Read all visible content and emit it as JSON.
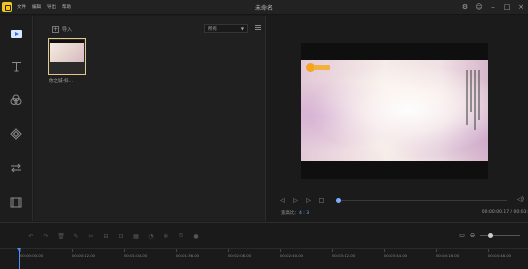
{
  "app": {
    "title": "未命名",
    "menu": [
      "文件",
      "编辑",
      "导出",
      "帮助"
    ]
  },
  "sidebar": {
    "items": [
      {
        "name": "media",
        "icon": "play-icon",
        "active": true
      },
      {
        "name": "text",
        "icon": "text-T-icon"
      },
      {
        "name": "filters",
        "icon": "three-circles-icon"
      },
      {
        "name": "overlays",
        "icon": "diamond-icon"
      },
      {
        "name": "transitions",
        "icon": "arrows-icon"
      },
      {
        "name": "elements",
        "icon": "film-icon"
      }
    ]
  },
  "library": {
    "import_label": "导入",
    "filter_value": "所有",
    "items": [
      {
        "label": "你之城-抖..."
      }
    ]
  },
  "preview": {
    "ratio_label": "宽高比：",
    "ratio_value": "4 : 3",
    "time_current": "00:00:00.17",
    "time_separator": " / ",
    "time_total": "00:03:"
  },
  "timeline": {
    "ticks": [
      "00:00:00.00",
      "00:00:12.00",
      "00:01:04.00",
      "00:01:36.00",
      "00:02:08.00",
      "00:02:40.00",
      "00:03:12.00",
      "00:03:44.00",
      "00:04:16.00",
      "00:04:48.00"
    ]
  }
}
